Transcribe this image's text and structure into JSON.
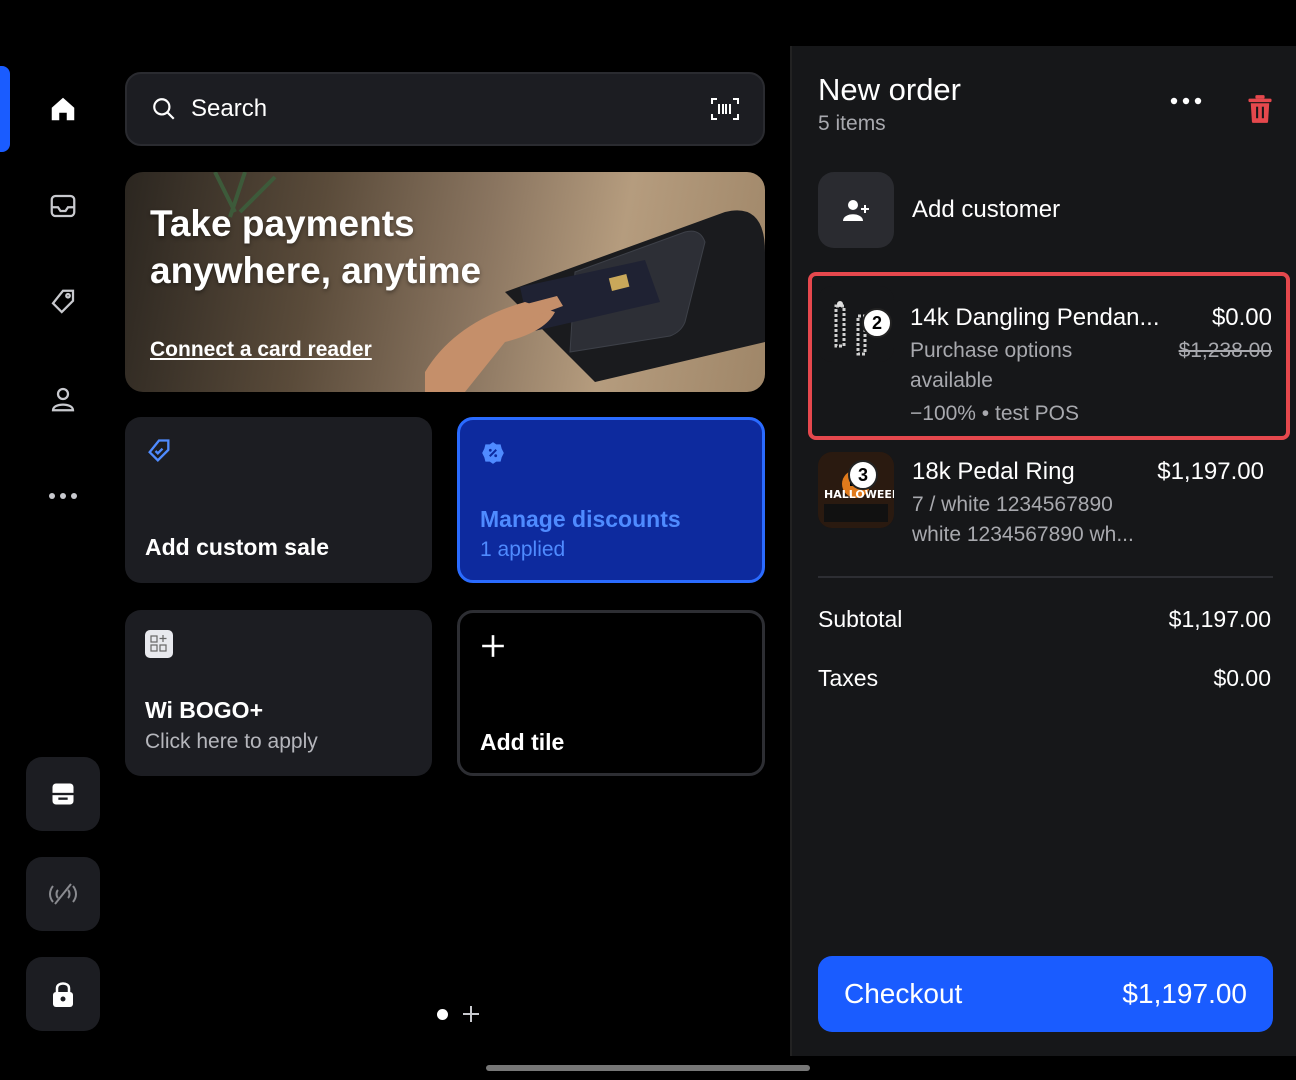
{
  "search": {
    "label": "Search"
  },
  "banner": {
    "title": "Take payments anywhere, anytime",
    "link": "Connect a card reader"
  },
  "tiles": {
    "custom_sale": {
      "label": "Add custom sale"
    },
    "discounts": {
      "label": "Manage discounts",
      "sub": "1 applied"
    },
    "bogo": {
      "label": "Wi BOGO+",
      "sub": "Click here to apply"
    },
    "add_tile": {
      "label": "Add tile"
    }
  },
  "order": {
    "title": "New order",
    "count": "5 items",
    "add_customer": "Add customer",
    "items": [
      {
        "qty": "2",
        "name": "14k Dangling Pendan...",
        "price": "$0.00",
        "original_price": "$1,238.00",
        "sub1": "Purchase options",
        "sub2": "available",
        "discount": "−100% • test POS"
      },
      {
        "qty": "3",
        "name": "18k Pedal Ring",
        "price": "$1,197.00",
        "sub1": "7 / white 1234567890",
        "sub2": "white 1234567890 wh...",
        "thumb_text": "HALLOWEEN"
      }
    ],
    "subtotal_label": "Subtotal",
    "subtotal_value": "$1,197.00",
    "taxes_label": "Taxes",
    "taxes_value": "$0.00",
    "checkout_label": "Checkout",
    "checkout_total": "$1,197.00"
  },
  "colors": {
    "accent": "#1a5cff",
    "danger": "#e5484d",
    "panel": "#161719",
    "tile": "#1c1d22"
  }
}
